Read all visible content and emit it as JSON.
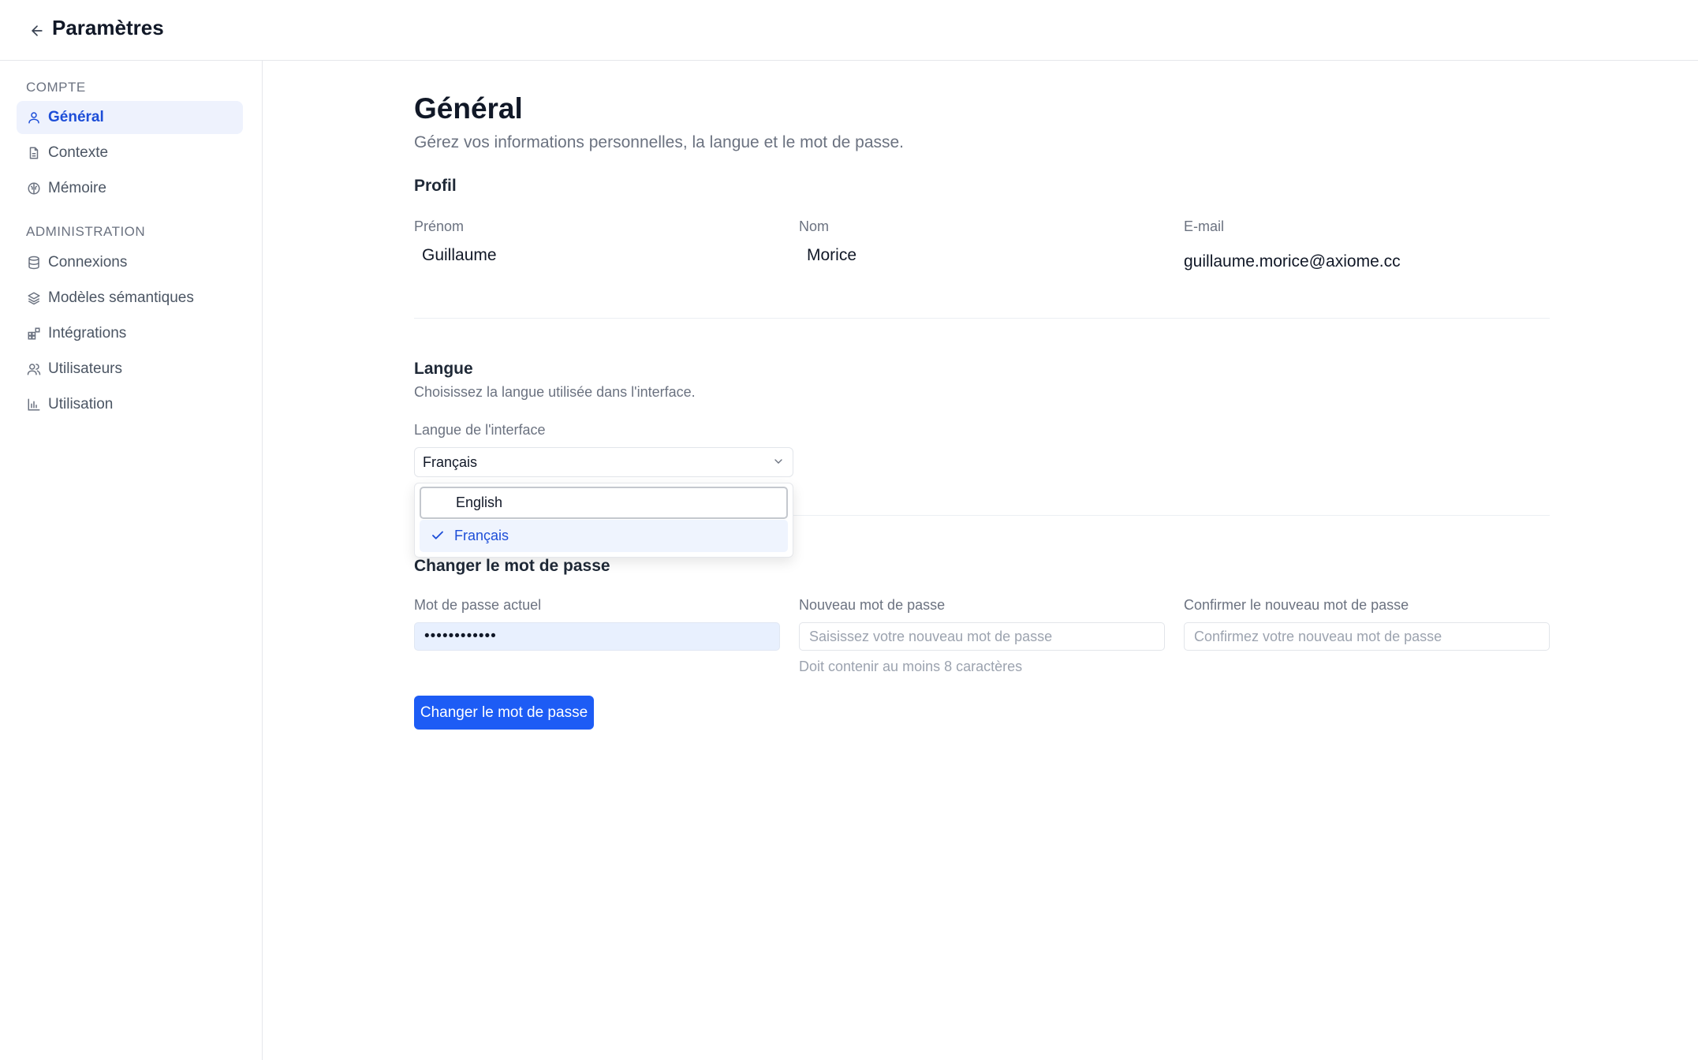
{
  "header": {
    "title": "Paramètres",
    "back_icon": "arrow-left-icon"
  },
  "sidebar": {
    "sections": [
      {
        "label": "COMPTE",
        "items": [
          {
            "label": "Général",
            "icon": "user-icon",
            "active": true
          },
          {
            "label": "Contexte",
            "icon": "document-icon"
          },
          {
            "label": "Mémoire",
            "icon": "brain-icon"
          }
        ]
      },
      {
        "label": "ADMINISTRATION",
        "items": [
          {
            "label": "Connexions",
            "icon": "database-icon"
          },
          {
            "label": "Modèles sémantiques",
            "icon": "layers-icon"
          },
          {
            "label": "Intégrations",
            "icon": "puzzle-icon"
          },
          {
            "label": "Utilisateurs",
            "icon": "users-icon"
          },
          {
            "label": "Utilisation",
            "icon": "bar-chart-icon"
          }
        ]
      }
    ]
  },
  "main": {
    "title": "Général",
    "subtitle": "Gérez vos informations personnelles, la langue et le mot de passe.",
    "profile": {
      "title": "Profil",
      "first_name_label": "Prénom",
      "first_name_value": "Guillaume",
      "last_name_label": "Nom",
      "last_name_value": "Morice",
      "email_label": "E-mail",
      "email_value": "guillaume.morice@axiome.cc"
    },
    "language": {
      "title": "Langue",
      "description": "Choisissez la langue utilisée dans l'interface.",
      "field_label": "Langue de l'interface",
      "selected": "Français",
      "options": [
        "English",
        "Français"
      ]
    },
    "password": {
      "title": "Changer le mot de passe",
      "current_label": "Mot de passe actuel",
      "current_value": "••••••••••••",
      "new_label": "Nouveau mot de passe",
      "new_placeholder": "Saisissez votre nouveau mot de passe",
      "new_hint": "Doit contenir au moins 8 caractères",
      "confirm_label": "Confirmer le nouveau mot de passe",
      "confirm_placeholder": "Confirmez votre nouveau mot de passe",
      "submit_label": "Changer le mot de passe"
    }
  },
  "colors": {
    "accent": "#1d5cf5",
    "active_bg": "#eef2fd",
    "active_text": "#1d4ed8"
  }
}
